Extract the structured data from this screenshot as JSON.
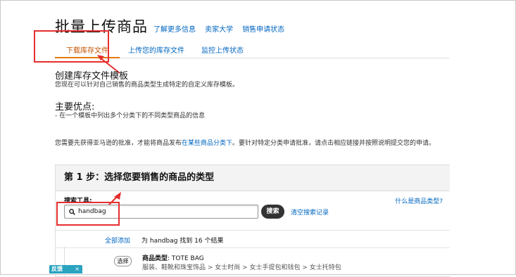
{
  "header": {
    "title": "批量上传商品",
    "links": [
      "了解更多信息",
      "卖家大学",
      "销售申请状态"
    ]
  },
  "tabs": [
    {
      "label": "下载库存文件",
      "active": true
    },
    {
      "label": "上传您的库存文件",
      "active": false
    },
    {
      "label": "监控上传状态",
      "active": false
    }
  ],
  "section": {
    "heading": "创建库存文件模板",
    "text": "您现在可以针对自己销售的商品类型生成特定的自定义库存模板。",
    "benefits_heading": "主要优点:",
    "benefits_text": "- 在一个模板中列出多个分类下的不同类型商品的信息",
    "approval_before": "您需要先获得亚马逊的批准，才能将商品发布",
    "approval_link": "在某些商品分类下",
    "approval_after": "。要针对特定分类申请批准，请点击相应链接并按照说明提交您的申请。"
  },
  "step": {
    "header": "第 1 步：选择您要销售的商品的类型",
    "search_label": "搜索工具:",
    "what_link": "什么是商品类型?",
    "search_value": "handbag",
    "search_button": "搜索",
    "clear_link": "清空搜索记录",
    "add_all": "全部添加",
    "found_text": "为 handbag 找到 16 个结果",
    "result": {
      "select_label": "选择",
      "type_label": "商品类型",
      "type_value": ": TOTE BAG",
      "path": "服装、鞋靴和珠宝饰品 > 女士时尚 > 女士手提包和钱包 > 女士托特包"
    }
  },
  "feedback": {
    "label": "反馈",
    "close": "×"
  },
  "colors": {
    "link": "#0066c0",
    "active_tab": "#c45500",
    "annotation": "#e62e2e",
    "tab_underline": "#e47911"
  }
}
